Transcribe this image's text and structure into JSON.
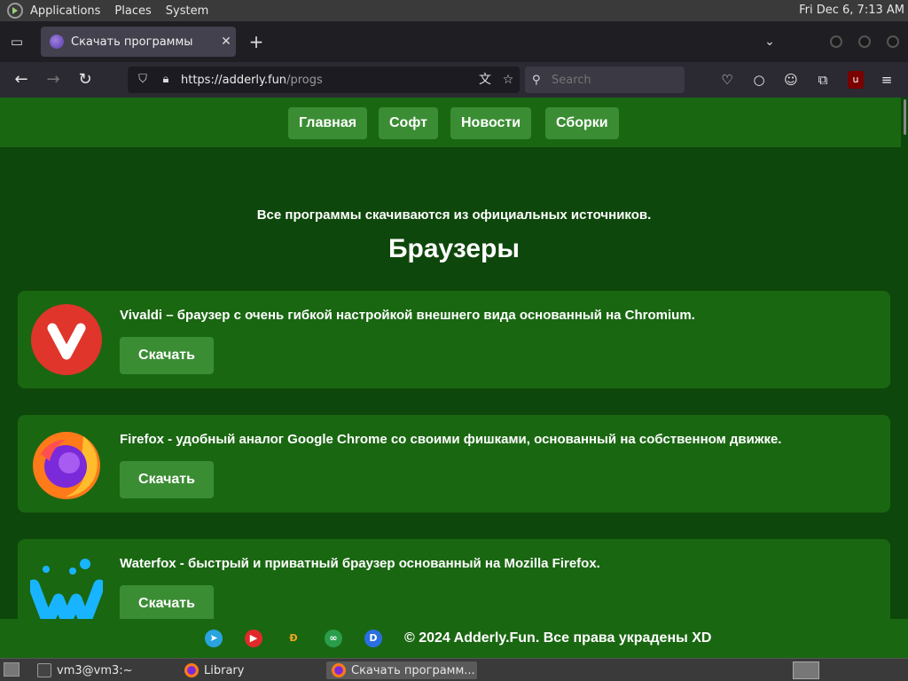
{
  "panel": {
    "menus": [
      "Applications",
      "Places",
      "System"
    ],
    "clock": "Fri Dec  6,  7:13 AM"
  },
  "browser": {
    "tab": {
      "title": "Скачать программы",
      "close": "✕"
    },
    "new_tab": "+",
    "url": {
      "host": "https://adderly.fun",
      "path": "/progs"
    },
    "search_placeholder": "Search"
  },
  "site": {
    "nav": [
      "Главная",
      "Софт",
      "Новости",
      "Сборки"
    ],
    "subtitle": "Все программы скачиваются из официальных источников.",
    "section_title": "Браузеры",
    "cards": [
      {
        "name": "Vivaldi",
        "desc": "Vivaldi – браузер с очень гибкой настройкой внешнего вида основанный на Chromium.",
        "button": "Скачать"
      },
      {
        "name": "Firefox",
        "desc": "Firefox - удобный аналог Google Chrome со своими фишками, основанный на собственном движке.",
        "button": "Скачать"
      },
      {
        "name": "Waterfox",
        "desc": "Waterfox - быстрый и приватный браузер основанный на Mozilla Firefox.",
        "button": "Скачать"
      }
    ],
    "footer": {
      "copyright": "© 2024 Adderly.Fun. Все права украдены XD"
    },
    "colors": {
      "page_bg": "#0e470b",
      "panel_bg": "#1a6712",
      "button_bg": "#3b8d34"
    }
  },
  "taskbar": {
    "items": [
      "vm3@vm3:~",
      "Library",
      "Скачать программ..."
    ]
  }
}
